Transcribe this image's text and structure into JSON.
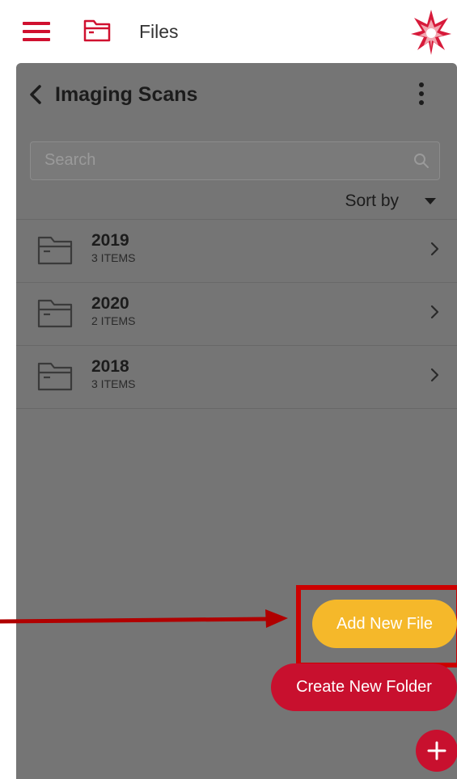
{
  "topbar": {
    "menu_icon": "hamburger-icon",
    "folder_icon": "folder-icon",
    "title": "Files",
    "logo": "flower-logo-icon"
  },
  "panel": {
    "title": "Imaging Scans",
    "back_icon": "chevron-left-icon",
    "more_icon": "kebab-menu-icon",
    "search": {
      "placeholder": "Search",
      "icon": "search-icon"
    },
    "sort": {
      "label": "Sort by",
      "icon": "caret-down-icon"
    },
    "folders": [
      {
        "name": "2019",
        "count": "3 ITEMS"
      },
      {
        "name": "2020",
        "count": "2 ITEMS"
      },
      {
        "name": "2018",
        "count": "3 ITEMS"
      }
    ]
  },
  "actions": {
    "add_file": "Add New File",
    "create_folder": "Create New Folder",
    "fab_icon": "plus-icon"
  },
  "colors": {
    "brand_red": "#c8102e",
    "accent_yellow": "#f5b82a",
    "overlay_gray": "#757575",
    "annotation_red": "#cc0000"
  }
}
